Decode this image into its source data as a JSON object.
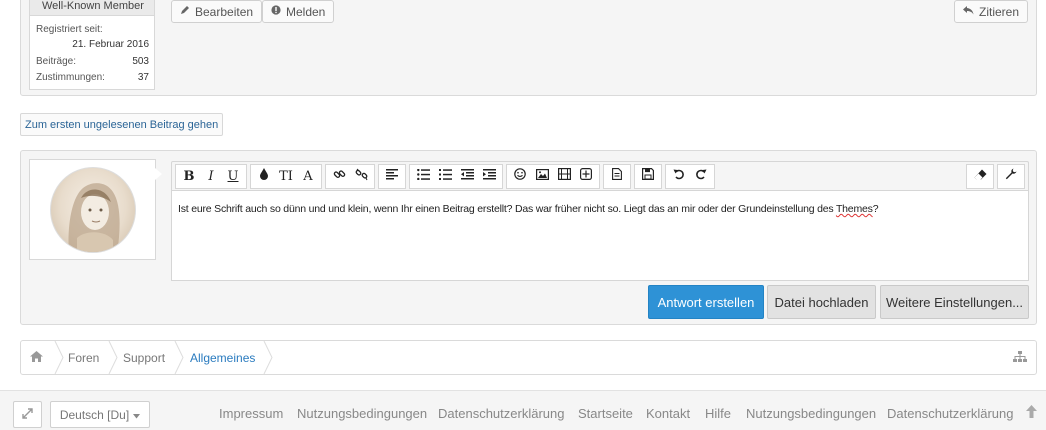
{
  "post": {
    "rank": "Well-Known Member",
    "registered_label": "Registriert seit:",
    "registered_value": "21. Februar 2016",
    "posts_label": "Beiträge:",
    "posts_value": "503",
    "likes_label": "Zustimmungen:",
    "likes_value": "37",
    "edit_label": "Bearbeiten",
    "report_label": "Melden",
    "quote_label": "Zitieren"
  },
  "unread_link": "Zum ersten ungelesenen Beitrag gehen",
  "editor": {
    "text_before": "Ist eure Schrift auch so dünn und und klein, wenn Ihr einen Beitrag erstellt? Das war früher nicht so. Liegt das an mir oder der Grundeinstellung des ",
    "text_misspelled": "Themes",
    "text_after": "?",
    "toolbar": {
      "bold": "B",
      "italic": "I",
      "underline": "U",
      "color": "color-drop-icon",
      "size": "TI",
      "font": "A",
      "link": "link-icon",
      "unlink": "unlink-icon",
      "align": "align-icon",
      "ul": "bullet-list-icon",
      "ol": "numbered-list-icon",
      "outdent": "outdent-icon",
      "indent": "indent-icon",
      "smilie": "smiley-icon",
      "image": "image-icon",
      "media": "media-icon",
      "insert": "insert-icon",
      "bbcode": "document-icon",
      "save": "save-icon",
      "undo": "undo-icon",
      "redo": "redo-icon",
      "eraser": "eraser-icon",
      "settings": "wrench-icon"
    }
  },
  "actions": {
    "submit": "Antwort erstellen",
    "upload": "Datei hochladen",
    "more": "Weitere Einstellungen..."
  },
  "breadcrumb": {
    "home_icon": "home-icon",
    "items": [
      "Foren",
      "Support",
      "Allgemeines"
    ],
    "sitemap_icon": "sitemap-icon"
  },
  "footer": {
    "language": "Deutsch [Du]",
    "links": [
      "Impressum",
      "Nutzungsbedingungen",
      "Datenschutzerklärung",
      "Startseite",
      "Kontakt",
      "Hilfe",
      "Nutzungsbedingungen",
      "Datenschutzerklärung"
    ]
  },
  "colors": {
    "primary": "#2e92d6",
    "link": "#2a6496",
    "active_crumb": "#2a7bbf"
  }
}
